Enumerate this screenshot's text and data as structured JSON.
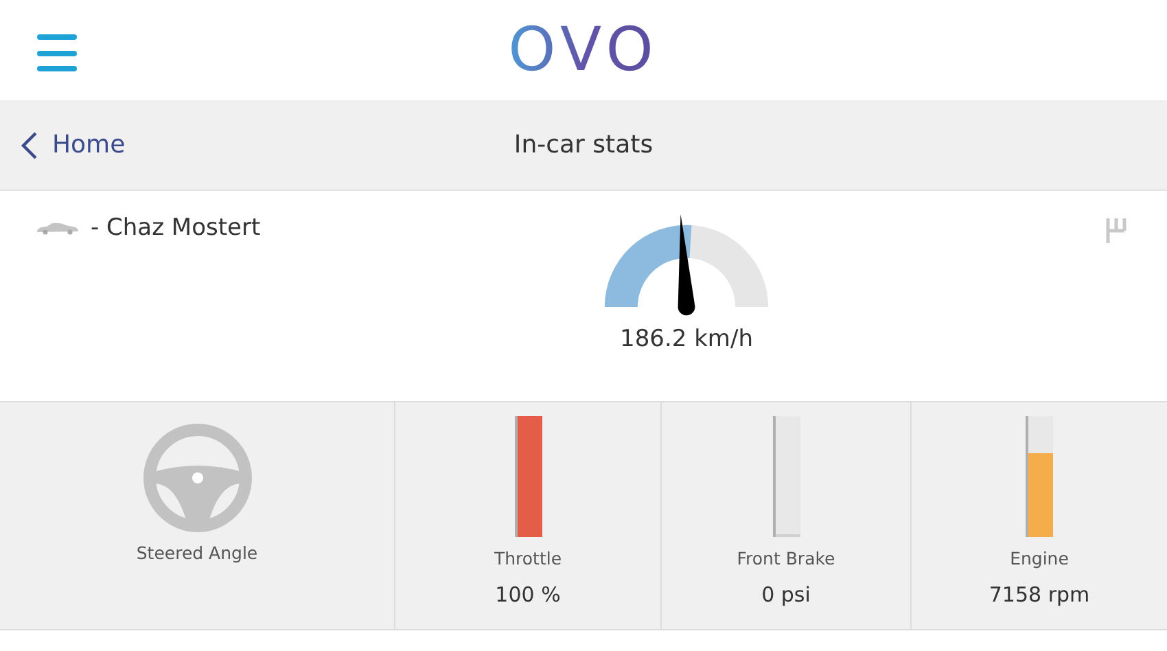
{
  "header": {
    "logo": "OVO"
  },
  "nav": {
    "back_label": "Home",
    "title": "In-car stats"
  },
  "driver": {
    "name": "- Chaz Mostert"
  },
  "speed": {
    "reading": "186.2 km/h"
  },
  "steering": {
    "label": "Steered Angle"
  },
  "meters": [
    {
      "label": "Throttle",
      "reading": "100 %",
      "level": 1,
      "color": "#e35d48"
    },
    {
      "label": "Front Brake",
      "reading": "0 psi",
      "level": 0
    },
    {
      "label": "Engine",
      "reading": "7158 rpm",
      "level": 0.69,
      "color": "#f5ad4b"
    }
  ]
}
